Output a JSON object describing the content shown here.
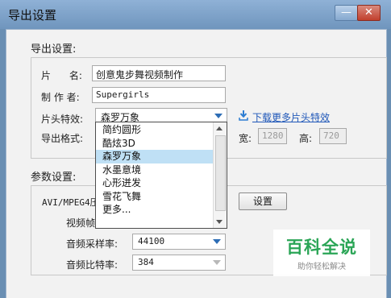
{
  "window": {
    "title": "导出设置",
    "minimize_glyph": "—",
    "close_glyph": "✕"
  },
  "export_section": {
    "heading": "导出设置:",
    "name_label": "片      名:",
    "name_value": "创意鬼步舞视频制作",
    "author_label": "制 作 者:",
    "author_value": "Supergirls",
    "intro_label": "片头特效:",
    "intro_selected": "森罗万象",
    "download_link": "下载更多片头特效",
    "format_label": "导出格式:",
    "width_label": "宽:",
    "width_value": "1280",
    "height_label": "高:",
    "height_value": "720"
  },
  "intro_dropdown": {
    "options": [
      "简约圆形",
      "酷炫3D",
      "森罗万象",
      "水墨意境",
      "心形迸发",
      "雪花飞舞",
      "更多..."
    ],
    "selected_index": 2
  },
  "params_section": {
    "heading": "参数设置:",
    "codec_label": "AVI/MPEG4压",
    "settings_button": "设置",
    "video_frame_label": "视频帧",
    "sample_rate_label": "音频采样率:",
    "sample_rate_value": "44100",
    "bitrate_label": "音频比特率:",
    "bitrate_value": "384"
  },
  "watermark": {
    "title": "百科全说",
    "subtitle": "助你轻松解决"
  },
  "colors": {
    "title_bar": "#7a9dc4",
    "link": "#1f57b8",
    "selected_item": "#bfe0f5",
    "watermark_green": "#2aa556"
  },
  "icons": [
    "download-icon",
    "dropdown-arrow-icon",
    "close-icon",
    "minimize-icon"
  ]
}
